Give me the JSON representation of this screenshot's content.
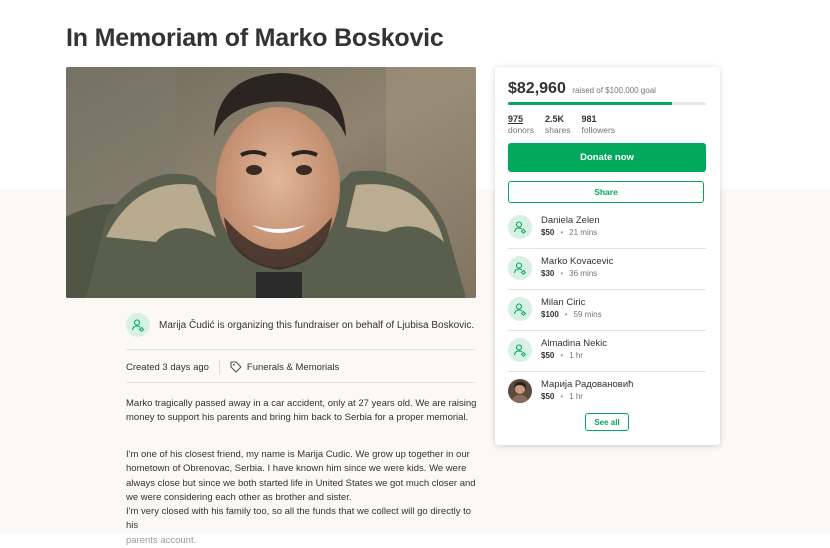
{
  "title": "In Memoriam of Marko Boskovic",
  "organizer": {
    "text": "Marija Čudić is organizing this fundraiser on behalf of Ljubisa Boskovic."
  },
  "meta": {
    "created": "Created 3 days ago",
    "category": "Funerals & Memorials",
    "category_icon": "tag-icon"
  },
  "story": {
    "p1": "Marko tragically passed away in a car accident, only at 27 years old. We are raising money to support his parents and bring him back to Serbia for a proper memorial.",
    "p2": "I'm one of his closest friend, my name is Marija Cudic. We grow up together in our hometown of Obrenovac, Serbia. I have known him since we were kids. We were always close but since we both started life in United States we got much closer and we were considering each other as brother and sister.",
    "p3a": "I'm very closed with his family too, so all the funds that we collect will go directly to his",
    "p3b": "parents account."
  },
  "campaign": {
    "raised": "$82,960",
    "goal_text": "raised of $100,000 goal",
    "progress_fraction": 0.8296,
    "stats": [
      {
        "value": "975",
        "label": "donors"
      },
      {
        "value": "2.5K",
        "label": "shares"
      },
      {
        "value": "981",
        "label": "followers"
      }
    ],
    "donate_label": "Donate now",
    "share_label": "Share",
    "see_all_label": "See all"
  },
  "donations": [
    {
      "name": "Daniela Zelen",
      "amount": "$50",
      "time": "21 mins",
      "avatar": "donor-icon"
    },
    {
      "name": "Marko Kovacevic",
      "amount": "$30",
      "time": "36 mins",
      "avatar": "donor-icon"
    },
    {
      "name": "Milan Ciric",
      "amount": "$100",
      "time": "59 mins",
      "avatar": "donor-icon"
    },
    {
      "name": "Almadina Nekic",
      "amount": "$50",
      "time": "1 hr",
      "avatar": "donor-icon"
    },
    {
      "name": "Марија Радовановић",
      "amount": "$50",
      "time": "1 hr",
      "avatar": "photo"
    }
  ],
  "colors": {
    "brand_green": "#02a95c",
    "avatar_bg": "#d7f1e5",
    "page_bg_lower": "#fbf8f6"
  }
}
